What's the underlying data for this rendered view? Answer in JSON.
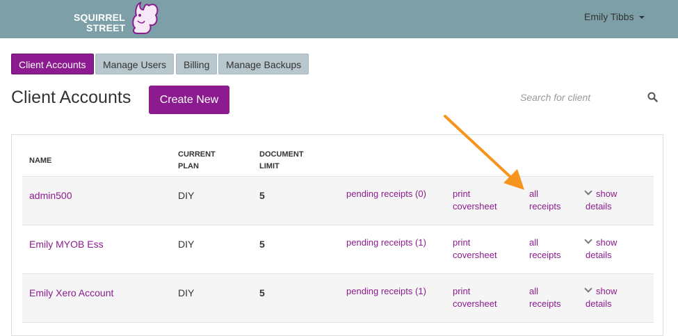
{
  "brand": {
    "line1": "SQUIRREL",
    "line2": "STREET"
  },
  "user": {
    "name": "Emily Tibbs"
  },
  "tabs": [
    {
      "label": "Client Accounts",
      "active": true
    },
    {
      "label": "Manage Users",
      "active": false
    },
    {
      "label": "Billing",
      "active": false
    },
    {
      "label": "Manage Backups",
      "active": false
    }
  ],
  "page": {
    "title": "Client Accounts",
    "create_label": "Create New"
  },
  "search": {
    "placeholder": "Search for client"
  },
  "table": {
    "headers": {
      "name": "NAME",
      "plan_1": "CURRENT",
      "plan_2": "PLAN",
      "limit_1": "DOCUMENT",
      "limit_2": "LIMIT"
    },
    "rows": [
      {
        "name": "admin500",
        "plan": "DIY",
        "limit": "5",
        "pending": "pending receipts (0)",
        "print_1": "print",
        "print_2": "coversheet",
        "all_1": "all",
        "all_2": "receipts",
        "show_1": "show",
        "show_2": "details"
      },
      {
        "name": "Emily MYOB Ess",
        "plan": "DIY",
        "limit": "5",
        "pending": "pending receipts (1)",
        "print_1": "print",
        "print_2": "coversheet",
        "all_1": "all",
        "all_2": "receipts",
        "show_1": "show",
        "show_2": "details"
      },
      {
        "name": "Emily Xero Account",
        "plan": "DIY",
        "limit": "5",
        "pending": "pending receipts (1)",
        "print_1": "print",
        "print_2": "coversheet",
        "all_1": "all",
        "all_2": "receipts",
        "show_1": "show",
        "show_2": "details"
      }
    ]
  },
  "colors": {
    "topbar": "#7da0a8",
    "accent": "#8b1b8e",
    "tab_inactive": "#b7c7cd",
    "arrow": "#f7941d"
  },
  "icons": [
    "squirrel-logo-icon",
    "caret-down-icon",
    "search-icon",
    "chevron-down-icon",
    "annotation-arrow-icon"
  ]
}
